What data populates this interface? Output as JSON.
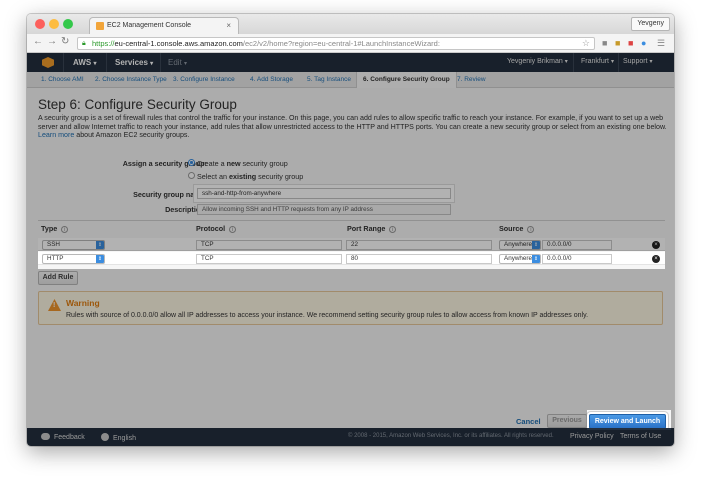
{
  "browser": {
    "tab_title": "EC2 Management Console",
    "tab_close": "×",
    "user": "Yevgeny",
    "back": "←",
    "forward": "→",
    "reload": "↻",
    "url_scheme": "https://",
    "url_host": "eu-central-1.console.aws.amazon.com",
    "url_path": "/ec2/v2/home?region=eu-central-1#LaunchInstanceWizard:",
    "star": "☆"
  },
  "awsnav": {
    "aws": "AWS",
    "services": "Services",
    "edit": "Edit",
    "caret": "▾",
    "user": "Yevgeniy Brikman",
    "region": "Frankfurt",
    "support": "Support"
  },
  "steps": [
    "1. Choose AMI",
    "2. Choose Instance Type",
    "3. Configure Instance",
    "4. Add Storage",
    "5. Tag Instance",
    "6. Configure Security Group",
    "7. Review"
  ],
  "page": {
    "title": "Step 6: Configure Security Group",
    "description": "A security group is a set of firewall rules that control the traffic for your instance. On this page, you can add rules to allow specific traffic to reach your instance. For example, if you want to set up a web server and allow Internet traffic to reach your instance, add rules that allow unrestricted access to the HTTP and HTTPS ports. You can create a new security group or select from an existing one below.",
    "learn_more": "Learn more",
    "learn_more_suffix": "about Amazon EC2 security groups."
  },
  "form": {
    "assign_label": "Assign a security group:",
    "opt_create_pre": "Create a ",
    "opt_create_bold": "new",
    "opt_create_post": " security group",
    "opt_select_pre": "Select an ",
    "opt_select_bold": "existing",
    "opt_select_post": " security group",
    "name_label": "Security group name:",
    "name_value": "ssh-and-http-from-anywhere",
    "desc_label": "Description:",
    "desc_value": "Allow incoming SSH and HTTP requests from any IP address"
  },
  "table": {
    "headers": [
      "Type",
      "Protocol",
      "Port Range",
      "Source"
    ],
    "info": "i",
    "rows": [
      {
        "type": "SSH",
        "protocol": "TCP",
        "port": "22",
        "source_type": "Anywhere",
        "source_cidr": "0.0.0.0/0"
      },
      {
        "type": "HTTP",
        "protocol": "TCP",
        "port": "80",
        "source_type": "Anywhere",
        "source_cidr": "0.0.0.0/0"
      }
    ],
    "select_arrow": "⇕",
    "delete": "×",
    "add_rule": "Add Rule"
  },
  "warning": {
    "icon_mark": "!",
    "title": "Warning",
    "body": "Rules with source of 0.0.0.0/0 allow all IP addresses to access your instance. We recommend setting security group rules to allow access from known IP addresses only."
  },
  "actions": {
    "cancel": "Cancel",
    "previous": "Previous",
    "review_launch": "Review and Launch"
  },
  "footer": {
    "feedback": "Feedback",
    "language": "English",
    "copyright": "© 2008 - 2015, Amazon Web Services, Inc. or its affiliates. All rights reserved.",
    "privacy": "Privacy Policy",
    "terms": "Terms of Use"
  },
  "colors": {
    "nav_bg": "#232f3e",
    "primary_button": "#2b72c7",
    "warning_title": "#e07d10",
    "link": "#1f6fb2"
  }
}
